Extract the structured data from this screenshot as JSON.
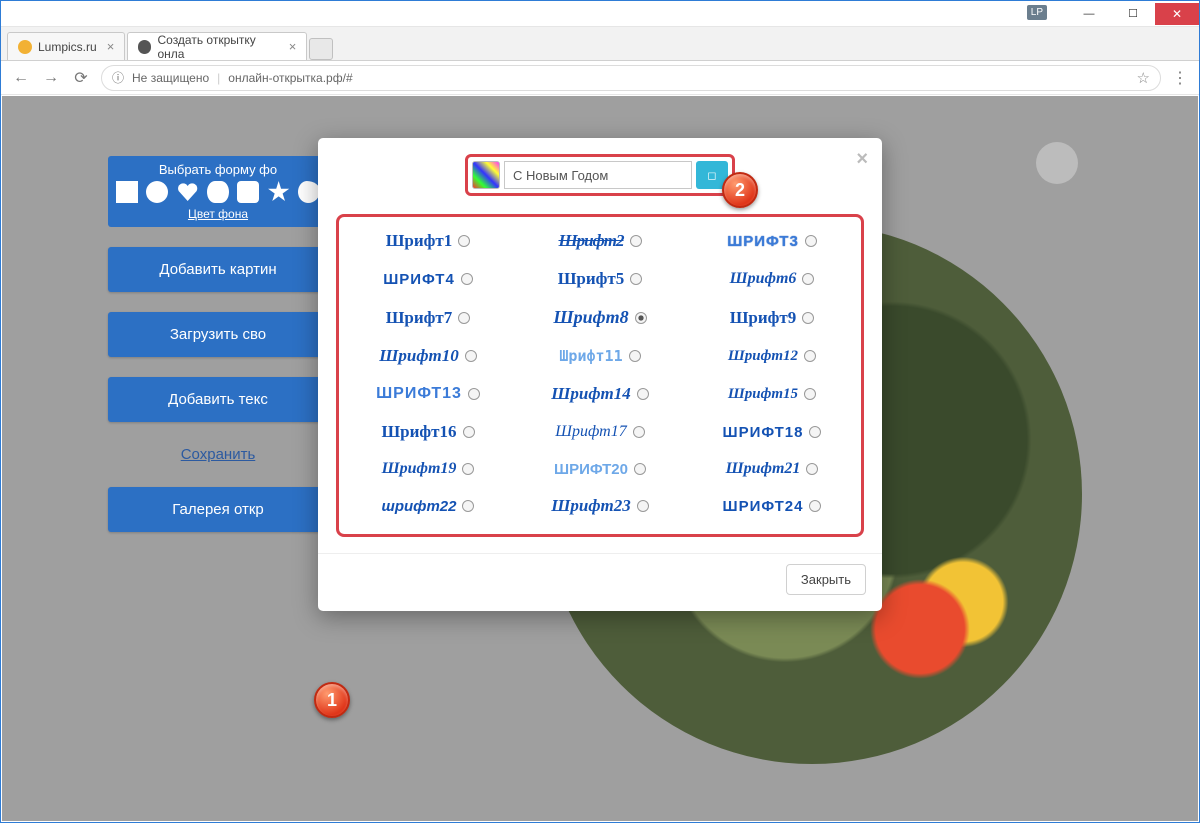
{
  "window": {
    "lp_badge": "LP"
  },
  "tabs": [
    {
      "title": "Lumpics.ru"
    },
    {
      "title": "Создать открытку онла"
    }
  ],
  "address_bar": {
    "security": "Не защищено",
    "url": "онлайн-открытка.рф/#"
  },
  "sidebar": {
    "shape_panel_title": "Выбрать форму фо",
    "color_link": "Цвет фона",
    "buttons": {
      "add_image": "Добавить картин",
      "upload": "Загрузить сво",
      "add_text": "Добавить текс",
      "save": "Сохранить",
      "gallery": "Галерея откр"
    }
  },
  "modal": {
    "text_value": "С Новым Годом",
    "close_label": "Закрыть",
    "fonts": [
      {
        "label": "Шрифт1",
        "cls": "f1",
        "selected": false
      },
      {
        "label": "Шрифт2",
        "cls": "f2",
        "selected": false
      },
      {
        "label": "ШРИФТ3",
        "cls": "f3",
        "selected": false
      },
      {
        "label": "ШРИФТ4",
        "cls": "f4",
        "selected": false
      },
      {
        "label": "Шрифт5",
        "cls": "f5",
        "selected": false
      },
      {
        "label": "Шрифт6",
        "cls": "f6",
        "selected": false
      },
      {
        "label": "Шрифт7",
        "cls": "f7",
        "selected": false
      },
      {
        "label": "Шрифт8",
        "cls": "f8",
        "selected": true
      },
      {
        "label": "Шрифт9",
        "cls": "f9",
        "selected": false
      },
      {
        "label": "Шрифт10",
        "cls": "f10",
        "selected": false
      },
      {
        "label": "Шрифт11",
        "cls": "f11",
        "selected": false
      },
      {
        "label": "Шрифт12",
        "cls": "f12",
        "selected": false
      },
      {
        "label": "ШРИФТ13",
        "cls": "f13",
        "selected": false
      },
      {
        "label": "Шрифт14",
        "cls": "f14",
        "selected": false
      },
      {
        "label": "Шрифт15",
        "cls": "f15",
        "selected": false
      },
      {
        "label": "Шрифт16",
        "cls": "f16",
        "selected": false
      },
      {
        "label": "Шрифт17",
        "cls": "f17",
        "selected": false
      },
      {
        "label": "ШРИФТ18",
        "cls": "f18",
        "selected": false
      },
      {
        "label": "Шрифт19",
        "cls": "f19",
        "selected": false
      },
      {
        "label": "ШРИФТ20",
        "cls": "f20",
        "selected": false
      },
      {
        "label": "Шрифт21",
        "cls": "f21",
        "selected": false
      },
      {
        "label": "шрифт22",
        "cls": "f22",
        "selected": false
      },
      {
        "label": "Шрифт23",
        "cls": "f23",
        "selected": false
      },
      {
        "label": "ШРИФТ24",
        "cls": "f24",
        "selected": false
      }
    ]
  },
  "annotations": {
    "b1": "1",
    "b2": "2"
  }
}
